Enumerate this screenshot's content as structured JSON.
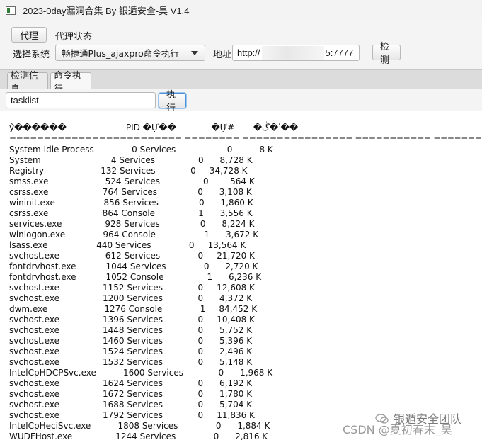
{
  "window": {
    "title": "2023-0day漏洞合集 By 银遁安全-昊 V1.4"
  },
  "toolbar": {
    "proxy_button": "代理",
    "proxy_status_label": "代理状态",
    "select_system_label": "选择系统",
    "system_selected": "畅捷通Plus_ajaxpro命令执行",
    "address_label": "地址",
    "address_prefix": "http://",
    "address_suffix": "5:7777",
    "detect_button": "检测"
  },
  "tabs": [
    {
      "label": "检测信息"
    },
    {
      "label": "命令执行"
    }
  ],
  "command": {
    "value": "tasklist",
    "execute_button": "执行"
  },
  "output": {
    "lines": [
      "ӳ������                      PID �Ự��             �Ự#       �ڴ�ʹ��",
      "========================= ======== ================ =========== ============",
      "System Idle Process              0 Services                   0          8 K",
      "System                          4 Services                0      8,728 K",
      "Registry                     132 Services             0     34,728 K",
      "smss.exe                     524 Services                0        564 K",
      "csrss.exe                    764 Services               0      3,108 K",
      "wininit.exe                  856 Services               0      1,860 K",
      "csrss.exe                    864 Console                1      3,556 K",
      "services.exe                928 Services               0      8,224 K",
      "winlogon.exe              964 Console                  1      3,672 K",
      "lsass.exe                  440 Services              0     13,564 K",
      "svchost.exe                 612 Services              0     21,720 K",
      "fontdrvhost.exe           1044 Services              0      2,720 K",
      "fontdrvhost.exe           1052 Console                1      6,236 K",
      "svchost.exe                1152 Services             0     12,608 K",
      "svchost.exe                1200 Services             0      4,372 K",
      "dwm.exe                     1276 Console              1     84,452 K",
      "svchost.exe                1396 Services             0     10,408 K",
      "svchost.exe                1448 Services             0      5,752 K",
      "svchost.exe                1460 Services             0      5,396 K",
      "svchost.exe                1524 Services             0      2,496 K",
      "svchost.exe                1532 Services             0      5,148 K",
      "IntelCpHDCPSvc.exe          1600 Services             0      1,968 K",
      "svchost.exe                1624 Services             0      6,192 K",
      "svchost.exe                1672 Services             0      1,780 K",
      "svchost.exe                1688 Services             0      5,704 K",
      "svchost.exe                1792 Services             0     11,836 K",
      "IntelCpHeciSvc.exe          1808 Services              0      1,884 K",
      "WUDFHost.exe                1244 Services              0      2,816 K"
    ]
  },
  "watermark": {
    "wechat": "银遁安全团队",
    "csdn": "CSDN @夏初春末_昊"
  }
}
